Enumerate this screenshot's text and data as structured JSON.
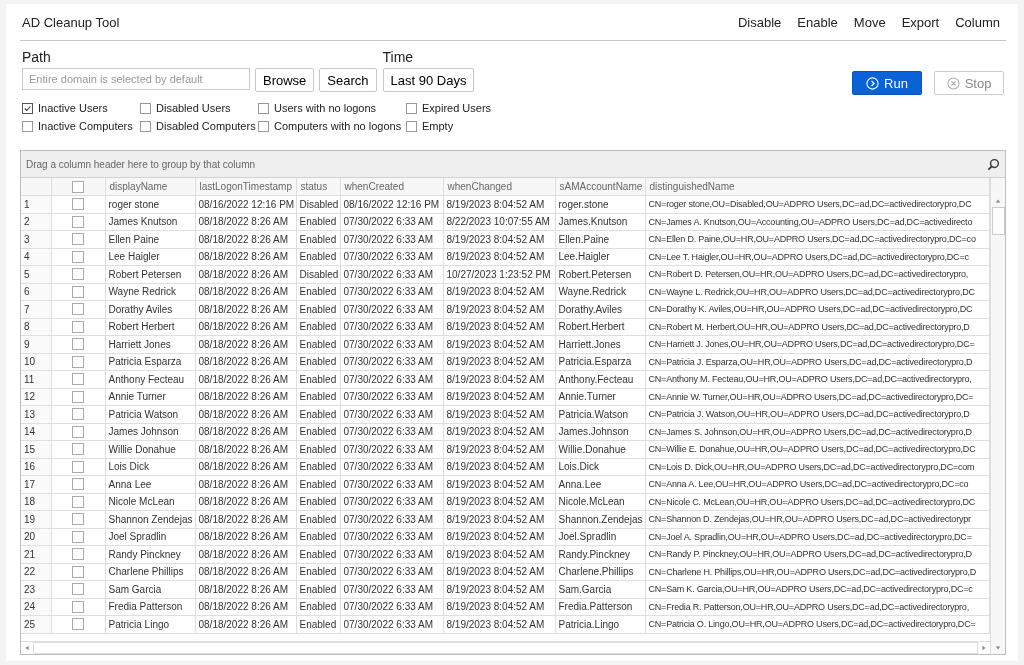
{
  "window": {
    "title": "AD Cleanup Tool"
  },
  "menu": [
    "Disable",
    "Enable",
    "Move",
    "Export",
    "Column"
  ],
  "path": {
    "label": "Path",
    "placeholder": "Entire domain is selected by default"
  },
  "buttons": {
    "browse": "Browse",
    "search": "Search"
  },
  "time": {
    "label": "Time",
    "value": "Last 90 Days"
  },
  "run": "Run",
  "stop": "Stop",
  "filters": [
    {
      "label": "Inactive Users",
      "checked": true
    },
    {
      "label": "Disabled Users",
      "checked": false
    },
    {
      "label": "Users with no logons",
      "checked": false
    },
    {
      "label": "Expired Users",
      "checked": false
    },
    {
      "label": "Inactive Computers",
      "checked": false
    },
    {
      "label": "Disabled Computers",
      "checked": false
    },
    {
      "label": "Computers with no logons",
      "checked": false
    },
    {
      "label": "Empty",
      "checked": false
    }
  ],
  "table": {
    "group_hint": "Drag a column header here to group by that column",
    "select_all_checked": false,
    "columns": [
      "displayName",
      "lastLogonTimestamp",
      "status",
      "whenCreated",
      "whenChanged",
      "sAMAccountName",
      "distinguishedName"
    ],
    "rows": [
      {
        "n": "1",
        "checked": false,
        "cells": [
          "roger stone",
          "08/16/2022 12:16 PM",
          "Disabled",
          "08/16/2022 12:16 PM",
          "8/19/2023 8:04:52 AM",
          "roger.stone",
          "CN=roger stone,OU=Disabled,OU=ADPRO Users,DC=ad,DC=activedirectorypro,DC"
        ]
      },
      {
        "n": "2",
        "checked": false,
        "cells": [
          "James Knutson",
          "08/18/2022 8:26 AM",
          "Enabled",
          "07/30/2022 6:33 AM",
          "8/22/2023 10:07:55 AM",
          "James.Knutson",
          "CN=James A. Knutson,OU=Accounting,OU=ADPRO Users,DC=ad,DC=activedirecto"
        ]
      },
      {
        "n": "3",
        "checked": false,
        "cells": [
          "Ellen Paine",
          "08/18/2022 8:26 AM",
          "Enabled",
          "07/30/2022 6:33 AM",
          "8/19/2023 8:04:52 AM",
          "Ellen.Paine",
          "CN=Ellen D. Paine,OU=HR,OU=ADPRO Users,DC=ad,DC=activedirectorypro,DC=co"
        ]
      },
      {
        "n": "4",
        "checked": false,
        "cells": [
          "Lee Haigler",
          "08/18/2022 8:26 AM",
          "Enabled",
          "07/30/2022 6:33 AM",
          "8/19/2023 8:04:52 AM",
          "Lee.Haigler",
          "CN=Lee T. Haigler,OU=HR,OU=ADPRO Users,DC=ad,DC=activedirectorypro,DC=c"
        ]
      },
      {
        "n": "5",
        "checked": false,
        "cells": [
          "Robert Petersen",
          "08/18/2022 8:26 AM",
          "Disabled",
          "07/30/2022 6:33 AM",
          "10/27/2023 1:23:52 PM",
          "Robert.Petersen",
          "CN=Robert D. Petersen,OU=HR,OU=ADPRO Users,DC=ad,DC=activedirectorypro,"
        ]
      },
      {
        "n": "6",
        "checked": false,
        "cells": [
          "Wayne Redrick",
          "08/18/2022 8:26 AM",
          "Enabled",
          "07/30/2022 6:33 AM",
          "8/19/2023 8:04:52 AM",
          "Wayne.Redrick",
          "CN=Wayne L. Redrick,OU=HR,OU=ADPRO Users,DC=ad,DC=activedirectorypro,DC"
        ]
      },
      {
        "n": "7",
        "checked": false,
        "cells": [
          "Dorathy Aviles",
          "08/18/2022 8:26 AM",
          "Enabled",
          "07/30/2022 6:33 AM",
          "8/19/2023 8:04:52 AM",
          "Dorathy.Aviles",
          "CN=Dorathy K. Aviles,OU=HR,OU=ADPRO Users,DC=ad,DC=activedirectorypro,DC"
        ]
      },
      {
        "n": "8",
        "checked": false,
        "cells": [
          "Robert Herbert",
          "08/18/2022 8:26 AM",
          "Enabled",
          "07/30/2022 6:33 AM",
          "8/19/2023 8:04:52 AM",
          "Robert.Herbert",
          "CN=Robert M. Herbert,OU=HR,OU=ADPRO Users,DC=ad,DC=activedirectorypro,D"
        ]
      },
      {
        "n": "9",
        "checked": false,
        "cells": [
          "Harriett Jones",
          "08/18/2022 8:26 AM",
          "Enabled",
          "07/30/2022 6:33 AM",
          "8/19/2023 8:04:52 AM",
          "Harriett.Jones",
          "CN=Harriett J. Jones,OU=HR,OU=ADPRO Users,DC=ad,DC=activedirectorypro,DC="
        ]
      },
      {
        "n": "10",
        "checked": false,
        "cells": [
          "Patricia Esparza",
          "08/18/2022 8:26 AM",
          "Enabled",
          "07/30/2022 6:33 AM",
          "8/19/2023 8:04:52 AM",
          "Patricia.Esparza",
          "CN=Patricia J. Esparza,OU=HR,OU=ADPRO Users,DC=ad,DC=activedirectorypro,D"
        ]
      },
      {
        "n": "11",
        "checked": false,
        "cells": [
          "Anthony Fecteau",
          "08/18/2022 8:26 AM",
          "Enabled",
          "07/30/2022 6:33 AM",
          "8/19/2023 8:04:52 AM",
          "Anthony.Fecteau",
          "CN=Anthony M. Fecteau,OU=HR,OU=ADPRO Users,DC=ad,DC=activedirectorypro,"
        ]
      },
      {
        "n": "12",
        "checked": false,
        "cells": [
          "Annie Turner",
          "08/18/2022 8:26 AM",
          "Enabled",
          "07/30/2022 6:33 AM",
          "8/19/2023 8:04:52 AM",
          "Annie.Turner",
          "CN=Annie W. Turner,OU=HR,OU=ADPRO Users,DC=ad,DC=activedirectorypro,DC="
        ]
      },
      {
        "n": "13",
        "checked": false,
        "cells": [
          "Patricia Watson",
          "08/18/2022 8:26 AM",
          "Enabled",
          "07/30/2022 6:33 AM",
          "8/19/2023 8:04:52 AM",
          "Patricia.Watson",
          "CN=Patricia J. Watson,OU=HR,OU=ADPRO Users,DC=ad,DC=activedirectorypro,D"
        ]
      },
      {
        "n": "14",
        "checked": false,
        "cells": [
          "James Johnson",
          "08/18/2022 8:26 AM",
          "Enabled",
          "07/30/2022 6:33 AM",
          "8/19/2023 8:04:52 AM",
          "James.Johnson",
          "CN=James S. Johnson,OU=HR,OU=ADPRO Users,DC=ad,DC=activedirectorypro,D"
        ]
      },
      {
        "n": "15",
        "checked": false,
        "cells": [
          "Willie Donahue",
          "08/18/2022 8:26 AM",
          "Enabled",
          "07/30/2022 6:33 AM",
          "8/19/2023 8:04:52 AM",
          "Willie.Donahue",
          "CN=Willie E. Donahue,OU=HR,OU=ADPRO Users,DC=ad,DC=activedirectorypro,DC"
        ]
      },
      {
        "n": "16",
        "checked": false,
        "cells": [
          "Lois Dick",
          "08/18/2022 8:26 AM",
          "Enabled",
          "07/30/2022 6:33 AM",
          "8/19/2023 8:04:52 AM",
          "Lois.Dick",
          "CN=Lois D. Dick,OU=HR,OU=ADPRO Users,DC=ad,DC=activedirectorypro,DC=com"
        ]
      },
      {
        "n": "17",
        "checked": false,
        "cells": [
          "Anna Lee",
          "08/18/2022 8:26 AM",
          "Enabled",
          "07/30/2022 6:33 AM",
          "8/19/2023 8:04:52 AM",
          "Anna.Lee",
          "CN=Anna A. Lee,OU=HR,OU=ADPRO Users,DC=ad,DC=activedirectorypro,DC=co"
        ]
      },
      {
        "n": "18",
        "checked": false,
        "cells": [
          "Nicole McLean",
          "08/18/2022 8:26 AM",
          "Enabled",
          "07/30/2022 6:33 AM",
          "8/19/2023 8:04:52 AM",
          "Nicole.McLean",
          "CN=Nicole C. McLean,OU=HR,OU=ADPRO Users,DC=ad,DC=activedirectorypro,DC"
        ]
      },
      {
        "n": "19",
        "checked": false,
        "cells": [
          "Shannon Zendejas",
          "08/18/2022 8:26 AM",
          "Enabled",
          "07/30/2022 6:33 AM",
          "8/19/2023 8:04:52 AM",
          "Shannon.Zendejas",
          "CN=Shannon D. Zendejas,OU=HR,OU=ADPRO Users,DC=ad,DC=activedirectorypr"
        ]
      },
      {
        "n": "20",
        "checked": false,
        "cells": [
          "Joel Spradlin",
          "08/18/2022 8:26 AM",
          "Enabled",
          "07/30/2022 6:33 AM",
          "8/19/2023 8:04:52 AM",
          "Joel.Spradlin",
          "CN=Joel A. Spradlin,OU=HR,OU=ADPRO Users,DC=ad,DC=activedirectorypro,DC="
        ]
      },
      {
        "n": "21",
        "checked": false,
        "cells": [
          "Randy Pinckney",
          "08/18/2022 8:26 AM",
          "Enabled",
          "07/30/2022 6:33 AM",
          "8/19/2023 8:04:52 AM",
          "Randy.Pinckney",
          "CN=Randy P. Pinckney,OU=HR,OU=ADPRO Users,DC=ad,DC=activedirectorypro,D"
        ]
      },
      {
        "n": "22",
        "checked": false,
        "cells": [
          "Charlene Phillips",
          "08/18/2022 8:26 AM",
          "Enabled",
          "07/30/2022 6:33 AM",
          "8/19/2023 8:04:52 AM",
          "Charlene.Phillips",
          "CN=Charlene H. Phillips,OU=HR,OU=ADPRO Users,DC=ad,DC=activedirectorypro,D"
        ]
      },
      {
        "n": "23",
        "checked": false,
        "cells": [
          "Sam Garcia",
          "08/18/2022 8:26 AM",
          "Enabled",
          "07/30/2022 6:33 AM",
          "8/19/2023 8:04:52 AM",
          "Sam.Garcia",
          "CN=Sam K. Garcia,OU=HR,OU=ADPRO Users,DC=ad,DC=activedirectorypro,DC=c"
        ]
      },
      {
        "n": "24",
        "checked": false,
        "cells": [
          "Fredia Patterson",
          "08/18/2022 8:26 AM",
          "Enabled",
          "07/30/2022 6:33 AM",
          "8/19/2023 8:04:52 AM",
          "Fredia.Patterson",
          "CN=Fredia R. Patterson,OU=HR,OU=ADPRO Users,DC=ad,DC=activedirectorypro,"
        ]
      },
      {
        "n": "25",
        "checked": false,
        "cells": [
          "Patricia Lingo",
          "08/18/2022 8:26 AM",
          "Enabled",
          "07/30/2022 6:33 AM",
          "8/19/2023 8:04:52 AM",
          "Patricia.Lingo",
          "CN=Patricia O. Lingo,OU=HR,OU=ADPRO Users,DC=ad,DC=activedirectorypro,DC="
        ]
      }
    ]
  }
}
